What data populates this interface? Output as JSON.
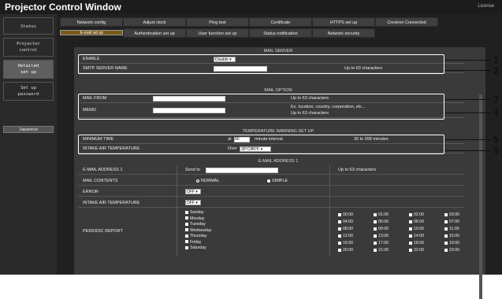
{
  "app": {
    "title": "Projector Control Window",
    "license": "License"
  },
  "sidebar": [
    {
      "label": "Status",
      "active": false
    },
    {
      "label": "Projector\ncontrol",
      "active": false
    },
    {
      "label": "Detailed\nset up",
      "active": true
    },
    {
      "label": "Set up\npassword",
      "active": false
    }
  ],
  "language_button": "Japanese",
  "tabs_row1": [
    "Network config",
    "Adjust clock",
    "Ping test",
    "Certificate",
    "HTTPS set up",
    "Crestron Connected"
  ],
  "tabs_row2": [
    "E-mail set up",
    "Authentication set up",
    "User function set up",
    "Status notification",
    "Network security"
  ],
  "mail_server": {
    "header": "MAIL SERVER",
    "enable_label": "ENABLE",
    "enable_value": "Disable",
    "smtp_label": "SMTP SERVER NAME",
    "smtp_note": "Up to 63 characters"
  },
  "mail_option": {
    "header": "MAIL OPTION",
    "from_label": "MAIL FROM",
    "from_note": "Up to 63 characters",
    "memo_label": "MEMO",
    "memo_note1": "Ex. location, country, corporation, etc...",
    "memo_note2": "Up to 63 characters"
  },
  "temp_warning": {
    "header": "TEMPERATURE WARNING SET UP",
    "min_label": "MINIMUM TIME",
    "min_prefix": "at",
    "min_value": "60",
    "min_suffix": "minute interval",
    "min_note": "30 to 999 minutes",
    "intake_label": "INTAKE AIR TEMPERATURE",
    "intake_prefix": "Over",
    "intake_value": "30°C/86°F"
  },
  "email1": {
    "header": "E-MAIL ADDRESS 1",
    "addr_label": "E-MAIL ADDRESS 1",
    "addr_prefix": "Send to",
    "addr_note": "Up to 63 characters",
    "contents_label": "MAIL CONTENTS",
    "normal": "NORMAL",
    "simple": "SIMPLE",
    "error_label": "ERROR",
    "error_value": "OFF",
    "intake_label": "INTAKE AIR TEMPERATURE",
    "intake_value": "OFF",
    "periodic_label": "PERIODIC REPORT",
    "days": [
      "Sunday",
      "Monday",
      "Tuesday",
      "Wednesday",
      "Thursday",
      "Friday",
      "Saturday"
    ],
    "times": [
      [
        "00:00",
        "01:00",
        "02:00",
        "03:00"
      ],
      [
        "04:00",
        "05:00",
        "06:00",
        "07:00"
      ],
      [
        "08:00",
        "09:00",
        "10:00",
        "11:00"
      ],
      [
        "12:00",
        "13:00",
        "14:00",
        "15:00"
      ],
      [
        "16:00",
        "17:00",
        "18:00",
        "19:00"
      ],
      [
        "20:00",
        "21:00",
        "22:00",
        "23:00"
      ]
    ]
  },
  "callouts": [
    "1",
    "2",
    "3",
    "4",
    "5",
    "6"
  ],
  "colors": {
    "titlebar": "#1c1c1c",
    "sidebar": "#2a2a2a",
    "content": "#3a3a3a",
    "tab_selected": "#7a5a18"
  }
}
